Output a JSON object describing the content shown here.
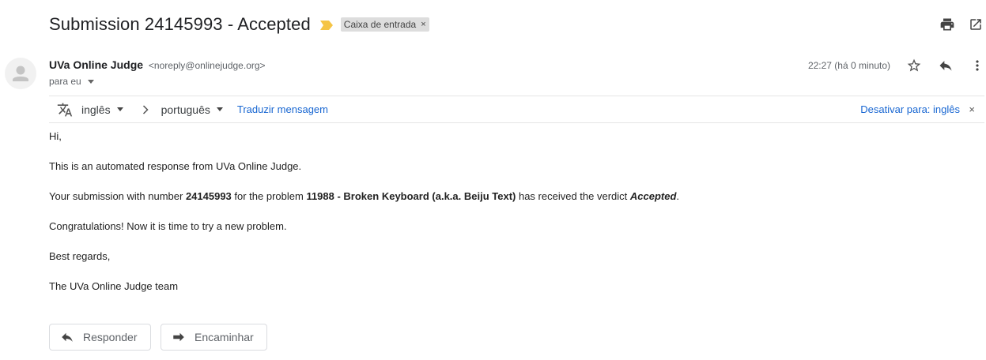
{
  "subject": "Submission 24145993 - Accepted",
  "label_chip": {
    "text": "Caixa de entrada",
    "remove": "×"
  },
  "colors": {
    "importance_marker": "#f5c445",
    "link": "#1967d2"
  },
  "top_icons": [
    "print-icon",
    "open-in-new-window-icon"
  ],
  "sender": {
    "name": "UVa Online Judge",
    "email": "<noreply@onlinejudge.org>",
    "to": "para eu",
    "time": "22:27 (há 0 minuto)"
  },
  "message_icons": [
    "star-icon",
    "reply-icon",
    "more-vert-icon"
  ],
  "translate": {
    "from_lang": "inglês",
    "to_lang": "português",
    "translate_link": "Traduzir mensagem",
    "disable_link": "Desativar para: inglês",
    "close": "×"
  },
  "body": {
    "greeting": "Hi,",
    "line1": "This is an automated response from UVa Online Judge.",
    "line2_pre": "Your submission with number ",
    "submission_number": "24145993",
    "line2_mid": " for the problem ",
    "problem": "11988 - Broken Keyboard (a.k.a. Beiju Text)",
    "line2_mid2": " has received the verdict ",
    "verdict": "Accepted",
    "line2_end": ".",
    "line3": "Congratulations! Now it is time to try a new problem.",
    "line4": "Best regards,",
    "signature": "The UVa Online Judge team"
  },
  "actions": {
    "reply": "Responder",
    "forward": "Encaminhar"
  }
}
